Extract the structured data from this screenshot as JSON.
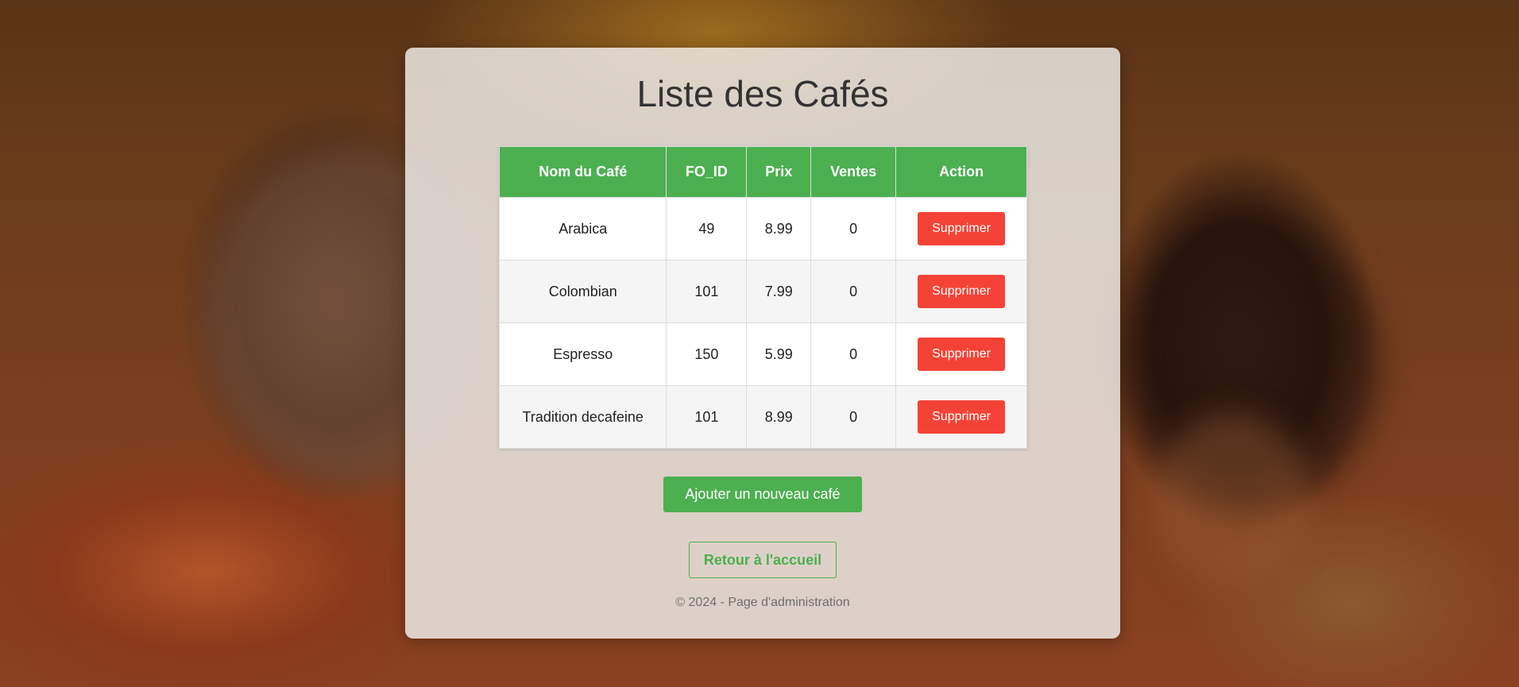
{
  "page": {
    "title": "Liste des Cafés",
    "footer": "© 2024 - Page d'administration"
  },
  "table": {
    "headers": [
      "Nom du Café",
      "FO_ID",
      "Prix",
      "Ventes",
      "Action"
    ],
    "rows": [
      {
        "name": "Arabica",
        "fo_id": "49",
        "prix": "8.99",
        "ventes": "0",
        "action": "Supprimer"
      },
      {
        "name": "Colombian",
        "fo_id": "101",
        "prix": "7.99",
        "ventes": "0",
        "action": "Supprimer"
      },
      {
        "name": "Espresso",
        "fo_id": "150",
        "prix": "5.99",
        "ventes": "0",
        "action": "Supprimer"
      },
      {
        "name": "Tradition decafeine",
        "fo_id": "101",
        "prix": "8.99",
        "ventes": "0",
        "action": "Supprimer"
      }
    ]
  },
  "actions": {
    "add_label": "Ajouter un nouveau café",
    "home_label": "Retour à l'accueil"
  },
  "colors": {
    "accent": "#4caf50",
    "danger": "#f44336"
  }
}
